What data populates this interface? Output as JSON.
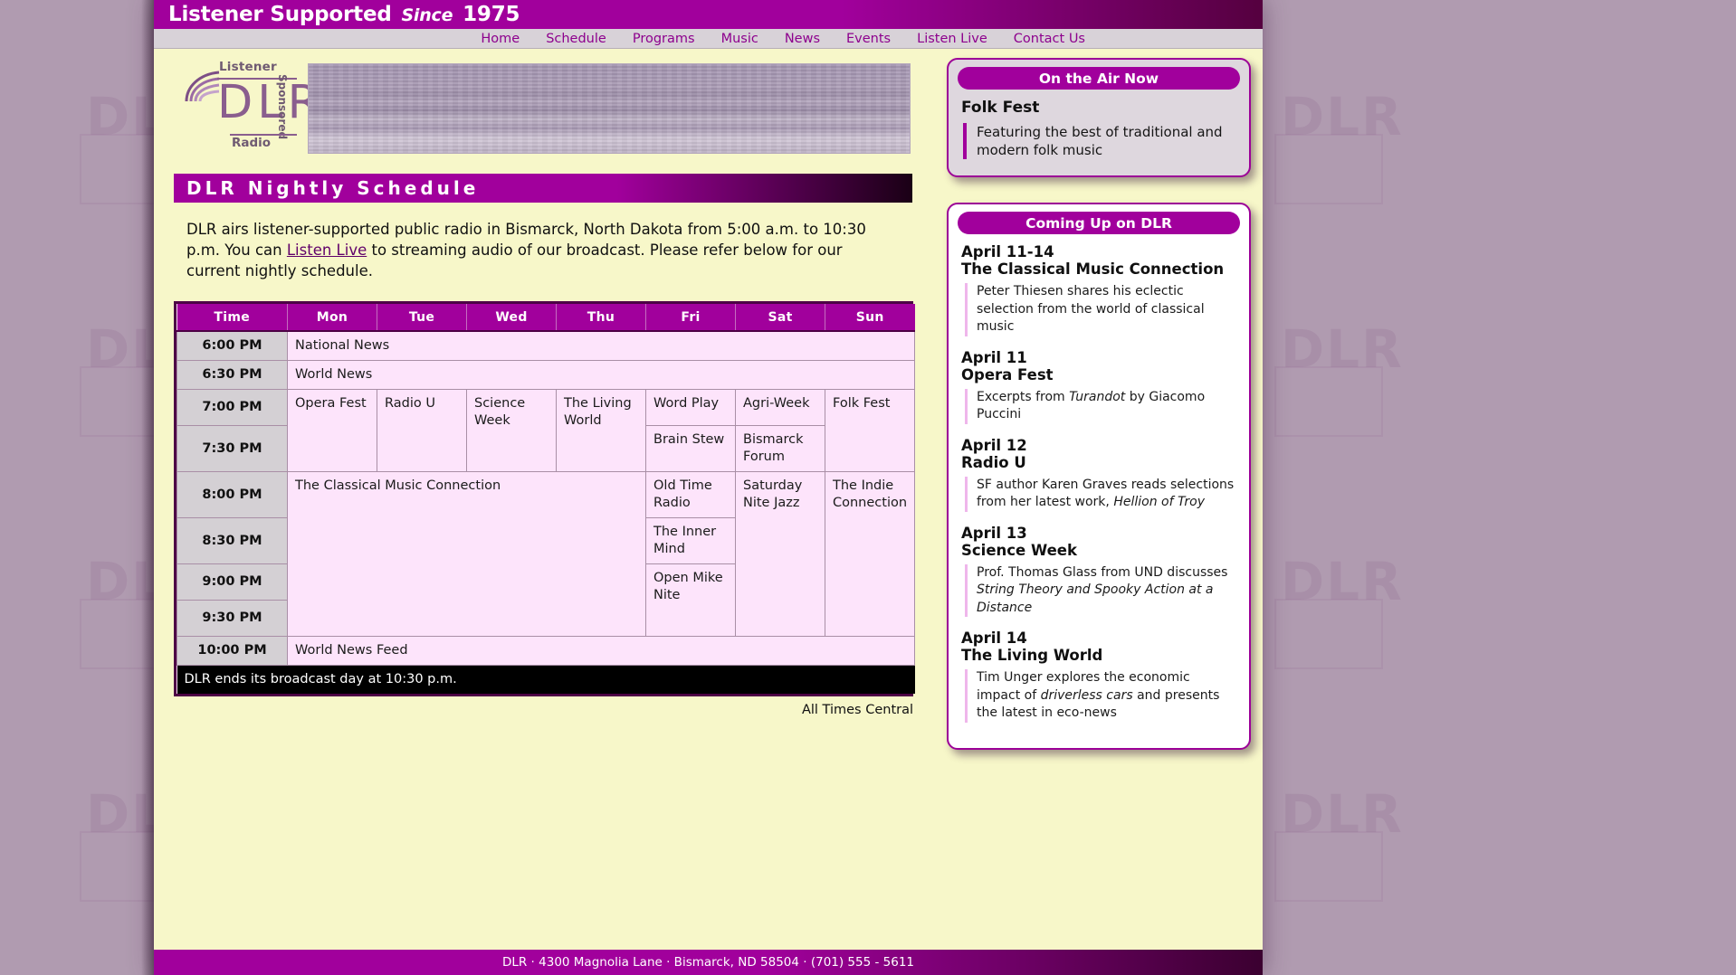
{
  "topbar": {
    "slogan_main": "Listener Supported",
    "slogan_since": "Since",
    "slogan_year": "1975"
  },
  "nav": {
    "items": [
      "Home",
      "Schedule",
      "Programs",
      "Music",
      "News",
      "Events",
      "Listen Live",
      "Contact Us"
    ]
  },
  "logo": {
    "listener": "Listener",
    "sponsored": "Sponsored",
    "radio": "Radio",
    "call": "DLR"
  },
  "page": {
    "title": "DLR Nightly Schedule",
    "intro_1": "DLR airs listener-supported public radio in Bismarck, North Dakota from 5:00 a.m. to 10:30 p.m. You can ",
    "intro_link": "Listen Live",
    "intro_2": " to streaming audio of our broadcast. Please refer below for our current nightly schedule.",
    "all_times": "All Times Central",
    "end_note": "DLR ends its broadcast day at 10:30 p.m."
  },
  "schedule": {
    "columns": [
      "Time",
      "Mon",
      "Tue",
      "Wed",
      "Thu",
      "Fri",
      "Sat",
      "Sun"
    ],
    "rows": [
      {
        "time": "6:00 PM",
        "cells": [
          {
            "text": "National News",
            "colspan": 7,
            "rowspan": 1
          }
        ]
      },
      {
        "time": "6:30 PM",
        "cells": [
          {
            "text": "World News",
            "colspan": 7,
            "rowspan": 1
          }
        ]
      },
      {
        "time": "7:00 PM",
        "cells": [
          {
            "text": "Opera Fest",
            "colspan": 1,
            "rowspan": 2
          },
          {
            "text": "Radio U",
            "colspan": 1,
            "rowspan": 2
          },
          {
            "text": "Science Week",
            "colspan": 1,
            "rowspan": 2
          },
          {
            "text": "The Living World",
            "colspan": 1,
            "rowspan": 2
          },
          {
            "text": "Word Play",
            "colspan": 1,
            "rowspan": 1
          },
          {
            "text": "Agri-Week",
            "colspan": 1,
            "rowspan": 1
          },
          {
            "text": "Folk Fest",
            "colspan": 1,
            "rowspan": 2
          }
        ]
      },
      {
        "time": "7:30 PM",
        "cells": [
          {
            "text": "Brain Stew",
            "colspan": 1,
            "rowspan": 1
          },
          {
            "text": "Bismarck Forum",
            "colspan": 1,
            "rowspan": 1
          }
        ]
      },
      {
        "time": "8:00 PM",
        "cells": [
          {
            "text": "The Classical Music Connection",
            "colspan": 4,
            "rowspan": 4
          },
          {
            "text": "Old Time Radio",
            "colspan": 1,
            "rowspan": 1
          },
          {
            "text": "Saturday Nite Jazz",
            "colspan": 1,
            "rowspan": 4
          },
          {
            "text": "The Indie Connection",
            "colspan": 1,
            "rowspan": 4
          }
        ]
      },
      {
        "time": "8:30 PM",
        "cells": [
          {
            "text": "The Inner Mind",
            "colspan": 1,
            "rowspan": 1
          }
        ]
      },
      {
        "time": "9:00 PM",
        "cells": [
          {
            "text": "Open Mike Nite",
            "colspan": 1,
            "rowspan": 2
          }
        ]
      },
      {
        "time": "9:30 PM",
        "cells": []
      },
      {
        "time": "10:00 PM",
        "cells": [
          {
            "text": "World News Feed",
            "colspan": 7,
            "rowspan": 1
          }
        ]
      }
    ]
  },
  "on_air": {
    "heading": "On the Air Now",
    "show": "Folk Fest",
    "description": "Featuring the best of traditional and modern folk music"
  },
  "coming_up": {
    "heading": "Coming Up on DLR",
    "items": [
      {
        "date": "April 11-14",
        "program": "The Classical Music Connection",
        "blurb_pre": "Peter Thiesen shares his eclectic selection from the world of classical music",
        "blurb_em": "",
        "blurb_post": ""
      },
      {
        "date": "April 11",
        "program": "Opera Fest",
        "blurb_pre": "Excerpts from ",
        "blurb_em": "Turandot",
        "blurb_post": " by Giacomo Puccini"
      },
      {
        "date": "April 12",
        "program": "Radio U",
        "blurb_pre": "SF author Karen Graves reads selections from her latest work, ",
        "blurb_em": "Hellion of Troy",
        "blurb_post": ""
      },
      {
        "date": "April 13",
        "program": "Science Week",
        "blurb_pre": "Prof. Thomas Glass from UND discusses ",
        "blurb_em": "String Theory and Spooky Action at a Distance",
        "blurb_post": ""
      },
      {
        "date": "April 14",
        "program": "The Living World",
        "blurb_pre": "Tim Unger explores the economic impact of ",
        "blurb_em": "driverless cars",
        "blurb_post": " and presents the latest in eco-news"
      }
    ]
  },
  "footer": {
    "text": "DLR · 4300 Magnolia Lane · Bismarck, ND 58504 · (701) 555 - 5611"
  },
  "colors": {
    "brand_purple": "#a1009c",
    "dark_purple": "#4d0045",
    "page_bg": "#f7f7c9",
    "table_bg": "#fde4fb",
    "time_bg": "#d4d0d4"
  }
}
